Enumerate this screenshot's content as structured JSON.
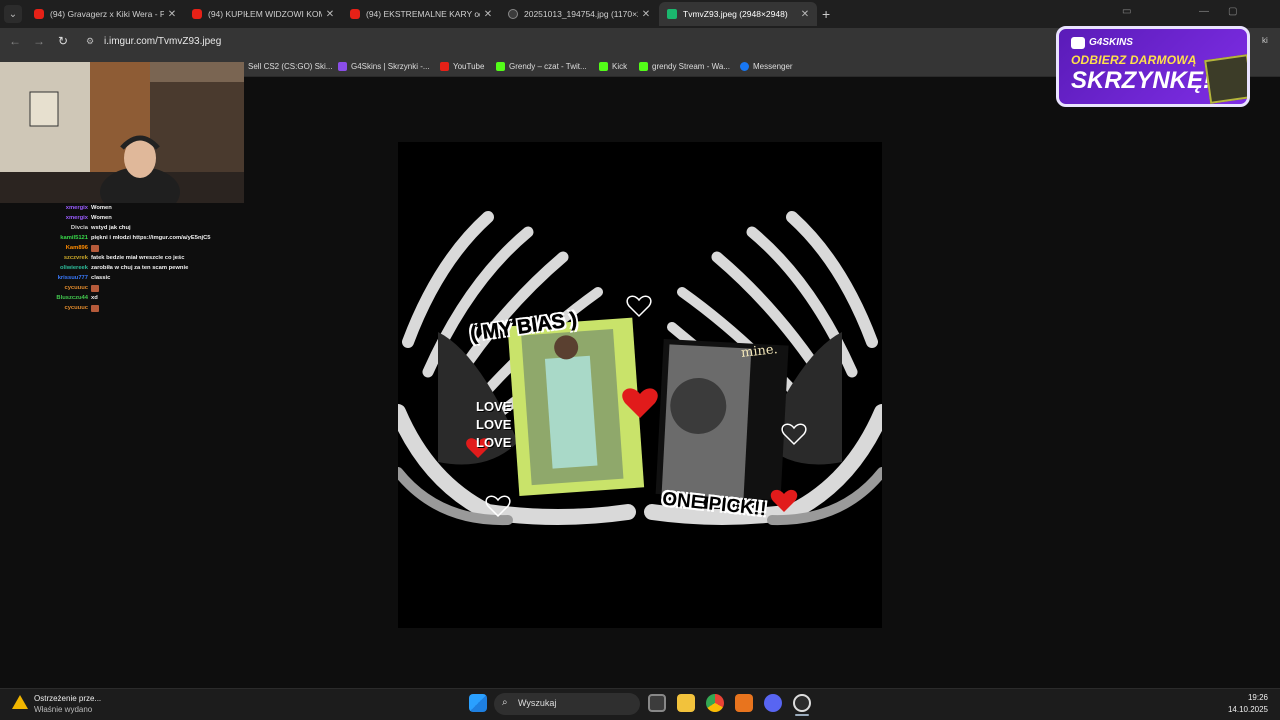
{
  "browser": {
    "tabs": [
      {
        "title": "(94) Gravagerz x Kiki Wera - Po",
        "favicon": "youtube-icon",
        "active": false
      },
      {
        "title": "(94) KUPIŁEM WIDZOWI KOMP",
        "favicon": "youtube-icon",
        "active": false
      },
      {
        "title": "(94) EKSTREMALNE KARY od B",
        "favicon": "youtube-icon",
        "active": false
      },
      {
        "title": "20251013_194754.jpg (1170×2",
        "favicon": "image-icon",
        "active": false
      },
      {
        "title": "TvmvZ93.jpeg (2948×2948)",
        "favicon": "imgur-icon",
        "active": true
      }
    ],
    "close_glyph": "✕",
    "new_tab_glyph": "+",
    "url": "i.imgur.com/TvmvZ93.jpeg",
    "bookmarks": [
      {
        "label": "Sell CS2 (CS:GO) Ski...",
        "icon": "store-icon"
      },
      {
        "label": "G4Skins | Skrzynki -...",
        "icon": "g4skins-icon"
      },
      {
        "label": "YouTube",
        "icon": "youtube-icon"
      },
      {
        "label": "Grendy – czat - Twit...",
        "icon": "kick-icon"
      },
      {
        "label": "Kick",
        "icon": "kick-icon"
      },
      {
        "label": "grendy Stream - Wa...",
        "icon": "kick-icon"
      },
      {
        "label": "Messenger",
        "icon": "messenger-icon"
      }
    ]
  },
  "image": {
    "caption_bias": "( MY BIAS )",
    "caption_love": [
      "LOVE",
      "LOVE",
      "LOVE"
    ],
    "caption_mine": "mine.",
    "caption_pick": "ONE PICK!!"
  },
  "chat": [
    {
      "user": "xmergix",
      "message": "Women",
      "user_color": "#9b5cff",
      "emote": false
    },
    {
      "user": "xmergix",
      "message": "Women",
      "user_color": "#9b5cff",
      "emote": false
    },
    {
      "user": "Divcia",
      "message": "wstyd jak chuj",
      "user_color": "#d0d0d0",
      "emote": false
    },
    {
      "user": "kamil5121",
      "message": "piękni i młodzi https://imgur.com/a/yE5njC5",
      "user_color": "#38d94a",
      "emote": false
    },
    {
      "user": "Kam896",
      "message": "",
      "user_color": "#ff8c00",
      "emote": true
    },
    {
      "user": "szczvrek",
      "message": "fatek bedzie miał wreszcie co jeśc",
      "user_color": "#c8a62a",
      "emote": false
    },
    {
      "user": "oliwiereek",
      "message": "zarobiła w chuj za ten scam pewnie",
      "user_color": "#2ebd9b",
      "emote": false
    },
    {
      "user": "krissuu777",
      "message": "classic",
      "user_color": "#3a7bff",
      "emote": false
    },
    {
      "user": "cycuuuc",
      "message": "",
      "user_color": "#e08a2c",
      "emote": true
    },
    {
      "user": "Bluszczu44",
      "message": "xd",
      "user_color": "#43c94f",
      "emote": false
    },
    {
      "user": "cycuuuc",
      "message": "",
      "user_color": "#e08a2c",
      "emote": true
    }
  ],
  "ad": {
    "brand": "G4SKINS",
    "line1": "ODBIERZ DARMOWĄ",
    "line2": "SKRZYNKĘ!"
  },
  "taskbar": {
    "notification_title": "Ostrzeżenie prze...",
    "notification_subtitle": "Właśnie wydano",
    "search_placeholder": "Wyszukaj",
    "time": "19:26",
    "date": "14.10.2025"
  }
}
